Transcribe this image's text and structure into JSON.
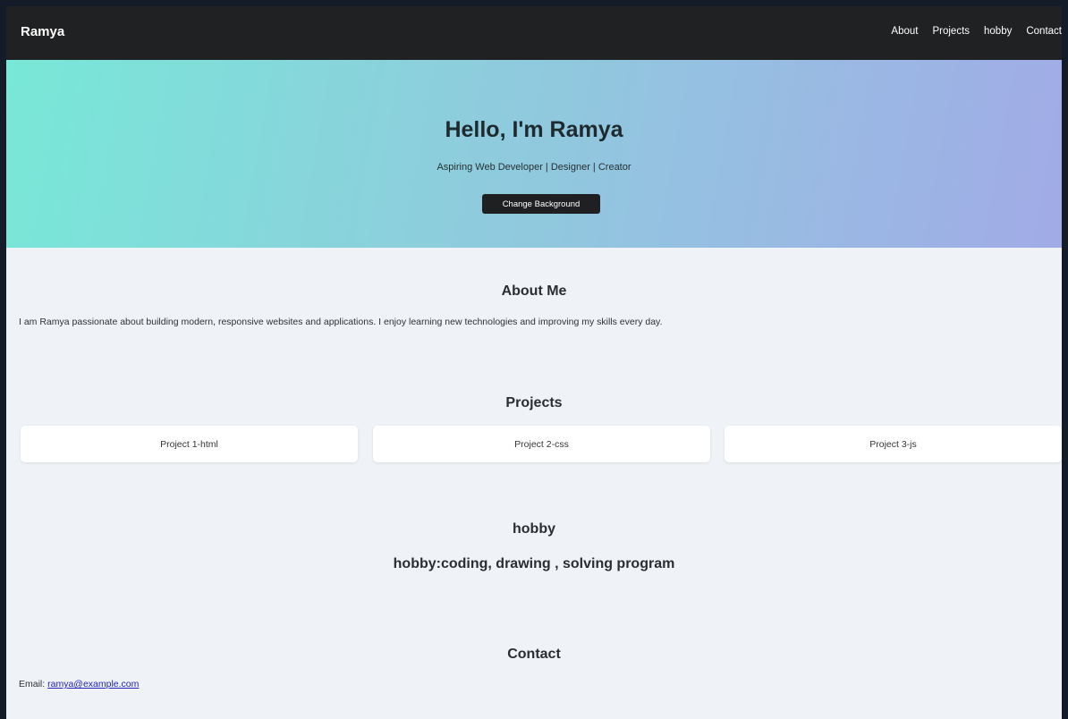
{
  "navbar": {
    "brand": "Ramya",
    "links": [
      "About",
      "Projects",
      "hobby",
      "Contact"
    ]
  },
  "hero": {
    "title": "Hello, I'm Ramya",
    "subtitle": "Aspiring Web Developer | Designer | Creator",
    "button_label": "Change Background",
    "gradient_colors": [
      "#78e8d8",
      "#a1abe6"
    ]
  },
  "about": {
    "title": "About Me",
    "text": "I am Ramya passionate about building modern, responsive websites and applications. I enjoy learning new technologies and improving my skills every day."
  },
  "projects": {
    "title": "Projects",
    "items": [
      "Project 1-html",
      "Project 2-css",
      "Project 3-js"
    ]
  },
  "hobby": {
    "title": "hobby",
    "text": "hobby:coding, drawing , solving program"
  },
  "contact": {
    "title": "Contact",
    "email_label": "Email:",
    "email": "ramya@example.com"
  },
  "colors": {
    "navbar_bg": "#202122",
    "page_bg": "#eff2f7",
    "link": "#2223bd"
  }
}
